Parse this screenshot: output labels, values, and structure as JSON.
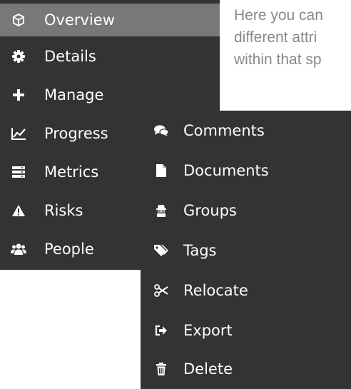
{
  "background_text": {
    "lines": [
      "Here you can",
      "different attri",
      "within that sp"
    ]
  },
  "menu": {
    "items": [
      {
        "label": "Overview",
        "icon": "cube-icon",
        "active": true
      },
      {
        "label": "Details",
        "icon": "gear-icon"
      },
      {
        "label": "Manage",
        "icon": "plus-icon"
      },
      {
        "label": "Progress",
        "icon": "line-chart-icon"
      },
      {
        "label": "Metrics",
        "icon": "server-icon"
      },
      {
        "label": "Risks",
        "icon": "warning-icon"
      },
      {
        "label": "People",
        "icon": "users-icon"
      }
    ]
  },
  "submenu": {
    "items": [
      {
        "label": "Comments",
        "icon": "comments-icon"
      },
      {
        "label": "Documents",
        "icon": "document-icon"
      },
      {
        "label": "Groups",
        "icon": "group-icon"
      },
      {
        "label": "Tags",
        "icon": "tags-icon"
      },
      {
        "label": "Relocate",
        "icon": "scissors-icon"
      },
      {
        "label": "Export",
        "icon": "export-icon"
      },
      {
        "label": "Delete",
        "icon": "trash-icon"
      }
    ]
  },
  "colors": {
    "menu_bg": "#333333",
    "active_bg": "#787878",
    "text": "#ffffff",
    "background_text": "#888888"
  }
}
